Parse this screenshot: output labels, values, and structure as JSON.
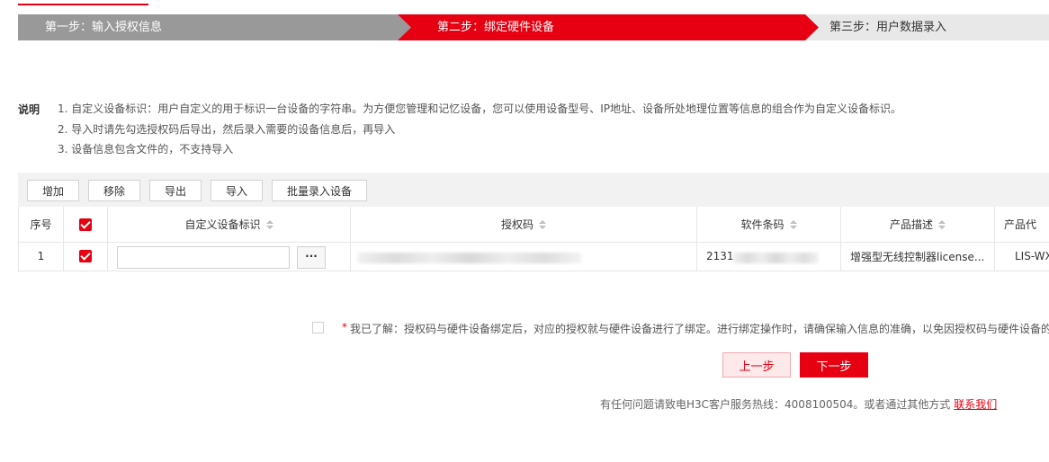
{
  "steps": [
    {
      "label": "第一步：输入授权信息",
      "state": "done"
    },
    {
      "label": "第二步：绑定硬件设备",
      "state": "active"
    },
    {
      "label": "第三步：用户数据录入",
      "state": "pending"
    }
  ],
  "notes": {
    "title": "说明",
    "items": [
      "1. 自定义设备标识：用户自定义的用于标识一台设备的字符串。为方便您管理和记忆设备，您可以使用设备型号、IP地址、设备所处地理位置等信息的组合作为自定义设备标识。",
      "2. 导入时请先勾选授权码后导出，然后录入需要的设备信息后，再导入",
      "3. 设备信息包含文件的，不支持导入"
    ]
  },
  "toolbar": {
    "add": "增加",
    "remove": "移除",
    "export": "导出",
    "import": "导入",
    "batch": "批量录入设备"
  },
  "table": {
    "headers": {
      "index": "序号",
      "device_id": "自定义设备标识",
      "auth_code": "授权码",
      "barcode": "软件条码",
      "product_desc": "产品描述",
      "product_code": "产品代"
    },
    "rows": [
      {
        "index": "1",
        "checked": true,
        "device_id": "",
        "more": "···",
        "auth_code": "",
        "barcode": "2131",
        "product_desc": "增强型无线控制器license...",
        "product_code": "LIS-WX"
      }
    ]
  },
  "agreement": {
    "required_mark": "*",
    "text": "我已了解：授权码与硬件设备绑定后，对应的授权就与硬件设备进行了绑定。进行绑定操作时，请确保输入信息的准确，以免因授权码与硬件设备的"
  },
  "buttons": {
    "prev": "上一步",
    "next": "下一步"
  },
  "footer": {
    "text": "有任何问题请致电H3C客户服务热线：4008100504。或者通过其他方式 ",
    "link": "联系我们"
  },
  "colors": {
    "accent": "#e60012",
    "step_done": "#999999",
    "step_pending": "#e8e8e8"
  }
}
